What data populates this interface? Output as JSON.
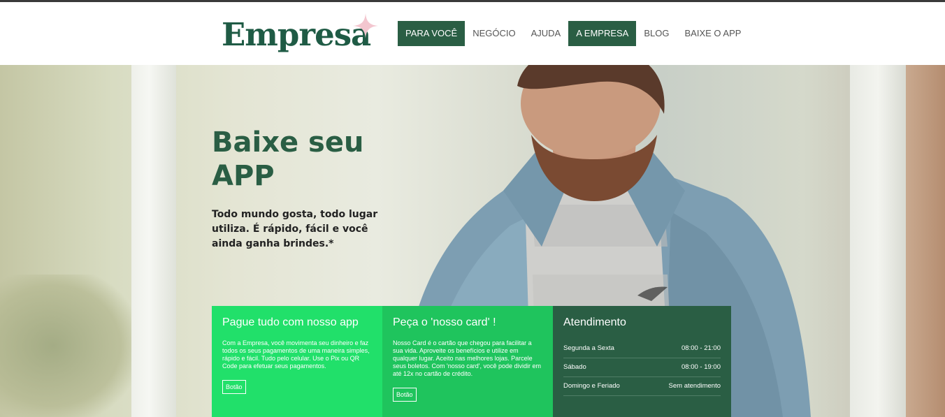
{
  "header": {
    "logo_text": "Empresa",
    "nav": [
      {
        "label": "PARA VOCÊ",
        "active": true
      },
      {
        "label": "NEGÓCIO",
        "active": false
      },
      {
        "label": "AJUDA",
        "active": false
      },
      {
        "label": "A EMPRESA",
        "active": true
      },
      {
        "label": "BLOG",
        "active": false
      },
      {
        "label": "BAIXE O APP",
        "active": false
      }
    ]
  },
  "hero": {
    "title": "Baixe seu APP",
    "subtitle": "Todo mundo gosta, todo lugar utiliza. É rápido, fácil e você ainda ganha brindes.*"
  },
  "cards": [
    {
      "title": "Pague tudo com nosso app",
      "text": "Com a Empresa, você movimenta seu dinheiro e faz todos os seus pagamentos de uma maneira simples, rápido e fácil. Tudo pelo celular. Use o Pix ou QR Code para efetuar seus pagamentos.",
      "button": "Botão"
    },
    {
      "title": "Peça o 'nosso card' !",
      "text": "Nosso Card é o cartão que chegou para facilitar a sua vida. Aproveite os benefícios e utilize em qualquer lugar. Aceito nas melhores lojas. Parcele seus boletos. Com 'nosso card', você pode dividir em até 12x no cartão de crédito.",
      "button": "Botão"
    },
    {
      "title": "Atendimento",
      "hours": [
        {
          "day": "Segunda a Sexta",
          "time": "08:00 - 21:00"
        },
        {
          "day": "Sábado",
          "time": "08:00 - 19:00"
        },
        {
          "day": "Domingo e Feriado",
          "time": "Sem atendimento"
        }
      ]
    }
  ],
  "colors": {
    "brand_dark_green": "#2a5e44",
    "bright_green": "#21e06a",
    "mid_green": "#1fc45d",
    "star_pink": "#f3c6cf"
  }
}
